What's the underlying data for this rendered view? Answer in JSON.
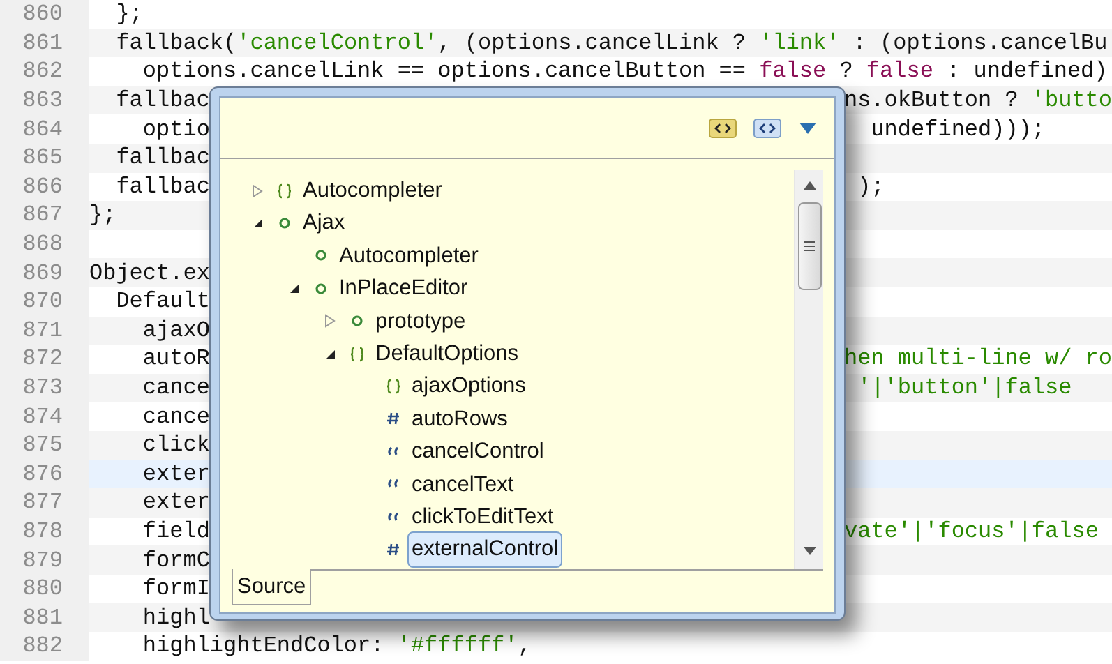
{
  "editor": {
    "lines": [
      {
        "number": "860",
        "current": false,
        "left": [
          {
            "text": "  };",
            "kind": "plain"
          }
        ]
      },
      {
        "number": "861",
        "current": false,
        "left": [
          {
            "text": "  fallback(",
            "kind": "plain"
          },
          {
            "text": "'cancelControl'",
            "kind": "string"
          },
          {
            "text": ", (options.cancelLink ? ",
            "kind": "plain"
          },
          {
            "text": "'link'",
            "kind": "string"
          },
          {
            "text": " : (options.cancelBu",
            "kind": "plain"
          }
        ]
      },
      {
        "number": "862",
        "current": false,
        "left": [
          {
            "text": "    options.cancelLink == options.cancelButton == ",
            "kind": "plain"
          },
          {
            "text": "false",
            "kind": "keyword"
          },
          {
            "text": " ? ",
            "kind": "plain"
          },
          {
            "text": "false",
            "kind": "keyword"
          },
          {
            "text": " : undefined)",
            "kind": "plain"
          }
        ]
      },
      {
        "number": "863",
        "current": false,
        "left": [
          {
            "text": "  fallbac",
            "kind": "plain"
          }
        ],
        "right": [
          {
            "text": "ns.okButton ? ",
            "kind": "plain"
          },
          {
            "text": "'butto",
            "kind": "string"
          }
        ]
      },
      {
        "number": "864",
        "current": false,
        "left": [
          {
            "text": "    optio",
            "kind": "plain"
          }
        ],
        "right": [
          {
            "text": "  undefined)));",
            "kind": "plain"
          }
        ]
      },
      {
        "number": "865",
        "current": false,
        "left": [
          {
            "text": "  fallbac",
            "kind": "plain"
          }
        ]
      },
      {
        "number": "866",
        "current": false,
        "left": [
          {
            "text": "  fallbac",
            "kind": "plain"
          }
        ],
        "right": [
          {
            "text": " );",
            "kind": "plain"
          }
        ]
      },
      {
        "number": "867",
        "current": false,
        "left": [
          {
            "text": "};",
            "kind": "plain"
          }
        ]
      },
      {
        "number": "868",
        "current": false
      },
      {
        "number": "869",
        "current": false,
        "left": [
          {
            "text": "Object.ex",
            "kind": "plain"
          }
        ]
      },
      {
        "number": "870",
        "current": false,
        "left": [
          {
            "text": "  Default",
            "kind": "plain"
          }
        ]
      },
      {
        "number": "871",
        "current": false,
        "left": [
          {
            "text": "    ajaxO",
            "kind": "plain"
          }
        ]
      },
      {
        "number": "872",
        "current": false,
        "left": [
          {
            "text": "    autoR",
            "kind": "plain"
          }
        ],
        "right": [
          {
            "text": "hen multi-line w/ ro",
            "kind": "comment"
          }
        ]
      },
      {
        "number": "873",
        "current": false,
        "left": [
          {
            "text": "    cance",
            "kind": "plain"
          }
        ],
        "right": [
          {
            "text": " '|'button'|false",
            "kind": "comment"
          }
        ]
      },
      {
        "number": "874",
        "current": false,
        "left": [
          {
            "text": "    cance",
            "kind": "plain"
          }
        ]
      },
      {
        "number": "875",
        "current": false,
        "left": [
          {
            "text": "    click",
            "kind": "plain"
          }
        ]
      },
      {
        "number": "876",
        "current": true,
        "left": [
          {
            "text": "    exter",
            "kind": "plain"
          }
        ]
      },
      {
        "number": "877",
        "current": false,
        "left": [
          {
            "text": "    exter",
            "kind": "plain"
          }
        ]
      },
      {
        "number": "878",
        "current": false,
        "left": [
          {
            "text": "    field",
            "kind": "plain"
          }
        ],
        "right": [
          {
            "text": "vate'|'focus'|false",
            "kind": "comment"
          }
        ]
      },
      {
        "number": "879",
        "current": false,
        "left": [
          {
            "text": "    formC",
            "kind": "plain"
          }
        ]
      },
      {
        "number": "880",
        "current": false,
        "left": [
          {
            "text": "    formI",
            "kind": "plain"
          }
        ]
      },
      {
        "number": "881",
        "current": false,
        "left": [
          {
            "text": "    highl",
            "kind": "plain"
          }
        ]
      },
      {
        "number": "882",
        "current": false,
        "left": [
          {
            "text": "    highlightEndColor: ",
            "kind": "plain"
          },
          {
            "text": "'#ffffff'",
            "kind": "string"
          },
          {
            "text": ",",
            "kind": "plain"
          }
        ]
      }
    ]
  },
  "popup": {
    "tree": [
      {
        "label": "Autocompleter",
        "kind": "object",
        "expanded": false,
        "selected": false
      },
      {
        "label": "Ajax",
        "kind": "member",
        "expanded": true,
        "selected": false,
        "children": [
          {
            "label": "Autocompleter",
            "kind": "member",
            "selected": false
          },
          {
            "label": "InPlaceEditor",
            "kind": "member",
            "expanded": true,
            "selected": false,
            "children": [
              {
                "label": "prototype",
                "kind": "member",
                "expanded": false,
                "selected": false
              },
              {
                "label": "DefaultOptions",
                "kind": "object",
                "expanded": true,
                "selected": false,
                "children": [
                  {
                    "label": "ajaxOptions",
                    "kind": "object",
                    "selected": false
                  },
                  {
                    "label": "autoRows",
                    "kind": "number",
                    "selected": false
                  },
                  {
                    "label": "cancelControl",
                    "kind": "string",
                    "selected": false
                  },
                  {
                    "label": "cancelText",
                    "kind": "string",
                    "selected": false
                  },
                  {
                    "label": "clickToEditText",
                    "kind": "string",
                    "selected": false
                  },
                  {
                    "label": "externalControl",
                    "kind": "number",
                    "selected": true
                  }
                ]
              }
            ]
          }
        ]
      }
    ],
    "tabs": [
      {
        "label": "Source",
        "selected": true
      }
    ]
  }
}
